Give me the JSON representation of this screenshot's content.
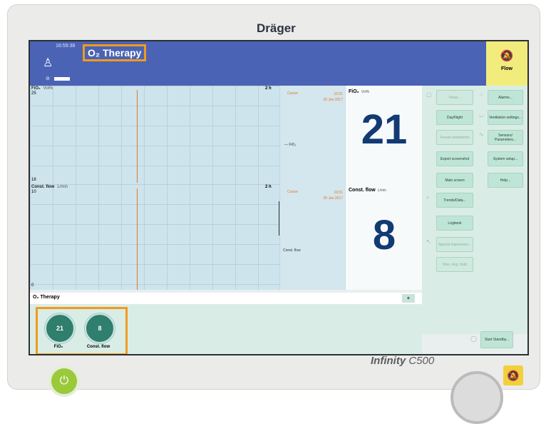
{
  "brand": "Dräger",
  "device_model": "Infinity",
  "device_variant": "C500",
  "header": {
    "time": "16:59:38",
    "mode_title": "O₂ Therapy",
    "alarm_label": "Flow"
  },
  "graphs": [
    {
      "label": "FiO₂",
      "unit": "Vol%",
      "top": "25",
      "bottom": "18",
      "timespan": "2 h",
      "cursor_label": "Cursor",
      "cursor_time": "16:51",
      "cursor_date": "20 Jan 2017",
      "legend": "FiO₂"
    },
    {
      "label": "Const. flow",
      "unit": "L/min",
      "top": "10",
      "bottom": "0",
      "timespan": "2 h",
      "cursor_label": "Cursor",
      "cursor_time": "16:51",
      "cursor_date": "20 Jan 2017",
      "legend": "Const. flow"
    }
  ],
  "parameters": [
    {
      "label": "FiO₂",
      "unit": "Vol%",
      "value": "21"
    },
    {
      "label": "Const. flow",
      "unit": "L/min",
      "value": "8"
    }
  ],
  "menu_col1": [
    {
      "label": "Views...",
      "enabled": false
    },
    {
      "label": "Day/Night",
      "enabled": true
    },
    {
      "label": "Freeze waveforms",
      "enabled": false
    },
    {
      "label": "Export screenshot",
      "enabled": true
    },
    {
      "label": "Main screen",
      "enabled": true
    },
    {
      "label": "Trends/Data...",
      "enabled": true
    },
    {
      "label": "Logbook",
      "enabled": true
    },
    {
      "label": "Special maneuvers...",
      "enabled": false
    },
    {
      "label": "Max. insp. hold",
      "enabled": false
    }
  ],
  "menu_col2": [
    {
      "label": "Alarms..."
    },
    {
      "label": "Ventilation settings..."
    },
    {
      "label": "Sensors/ Parameters..."
    },
    {
      "label": "System setup..."
    },
    {
      "label": "Help..."
    }
  ],
  "therapy_bar": {
    "label": "O₂ Therapy",
    "plus": "+"
  },
  "dials": [
    {
      "value": "21",
      "label": "FiO₂"
    },
    {
      "value": "8",
      "label": "Const. flow"
    }
  ],
  "standby": "Start Standby..."
}
